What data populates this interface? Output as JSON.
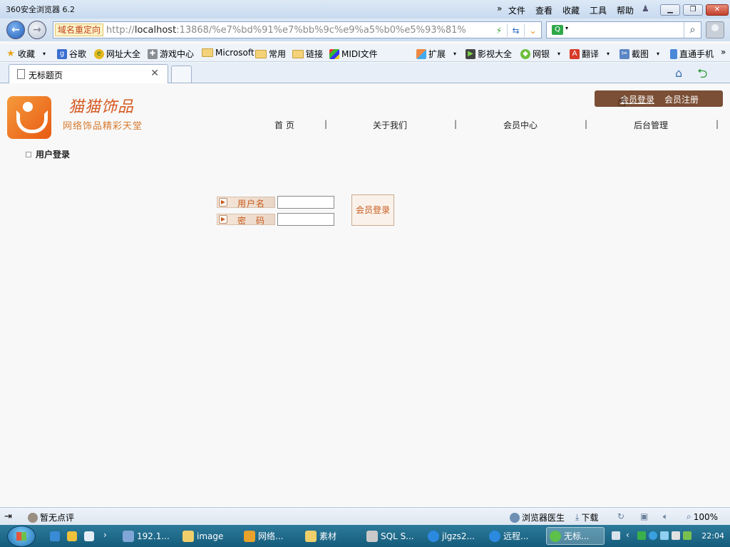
{
  "browser": {
    "title": "360安全浏览器 6.2",
    "menus": [
      "文件",
      "查看",
      "收藏",
      "工具",
      "帮助"
    ],
    "redirect_tag": "域名重定向",
    "url_prefix": "http://",
    "url_host": "localhost",
    "url_rest": ":13868/%e7%bd%91%e7%bb%9c%e9%a5%b0%e5%93%81%",
    "search_value": ""
  },
  "bookmarks": [
    {
      "label": "收藏",
      "icon": "star-icon"
    },
    {
      "label": "谷歌",
      "icon": "google-icon"
    },
    {
      "label": "网址大全",
      "icon": "url-guide-icon"
    },
    {
      "label": "游戏中心",
      "icon": "gamepad-icon"
    },
    {
      "label": "Microsoft",
      "icon": "folder-icon"
    },
    {
      "label": "常用",
      "icon": "folder-icon"
    },
    {
      "label": "链接",
      "icon": "folder-icon"
    },
    {
      "label": "MIDI文件",
      "icon": "windows-icon"
    },
    {
      "label": "扩展",
      "icon": "extension-icon"
    },
    {
      "label": "影视大全",
      "icon": "video-icon"
    },
    {
      "label": "网银",
      "icon": "bank-icon"
    },
    {
      "label": "翻译",
      "icon": "translate-icon"
    },
    {
      "label": "截图",
      "icon": "screenshot-icon"
    },
    {
      "label": "直通手机",
      "icon": "phone-icon"
    }
  ],
  "tab": {
    "label": "无标题页"
  },
  "site": {
    "brand_name": "猫猫饰品",
    "slogan": "网络饰品精彩天堂",
    "member_login": "会员登录",
    "member_register": "会员注册",
    "nav": [
      "首 页",
      "关于我们",
      "会员中心",
      "后台管理"
    ],
    "nav_separator": "|",
    "section_title": "用户登录"
  },
  "login_form": {
    "username_label": "用户名",
    "password_label": "密　码",
    "username_value": "",
    "password_value": "",
    "submit_label": "会员登录"
  },
  "statusbar": {
    "rating": "暂无点评",
    "doctor": "浏览器医生",
    "download": "下载",
    "zoom": "100%"
  },
  "taskbar": {
    "items": [
      {
        "label": "192.1...",
        "icon": "network-icon",
        "active": false
      },
      {
        "label": "image",
        "icon": "folder-icon",
        "active": false
      },
      {
        "label": "网络...",
        "icon": "visual-studio-icon",
        "active": false
      },
      {
        "label": "素材",
        "icon": "folder-icon",
        "active": false
      },
      {
        "label": "SQL S...",
        "icon": "sql-server-icon",
        "active": false
      },
      {
        "label": "jlgzs2...",
        "icon": "qq-icon",
        "active": false
      },
      {
        "label": "远程...",
        "icon": "qq-icon",
        "active": false
      },
      {
        "label": "无标...",
        "icon": "browser-360-icon",
        "active": true
      }
    ],
    "clock": "22:04"
  }
}
